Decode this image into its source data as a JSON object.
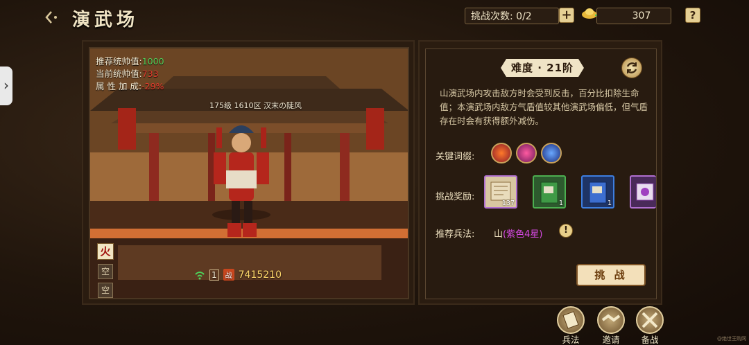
{
  "header": {
    "title": "演武场",
    "challenge_count": "挑战次数: 0/2",
    "gold": "307",
    "help": "?"
  },
  "left": {
    "stats": {
      "recommended_label": "推荐统帅值:",
      "recommended_value": "1000",
      "current_label": "当前统帅值:",
      "current_value": "733",
      "bonus_label": "属 性 加 成:",
      "bonus_value": "-29%"
    },
    "player_line": "175级  1610区 汉末の陡风",
    "element": "火",
    "slots": [
      "空",
      "空"
    ],
    "power": "7415210",
    "power_badge": "战",
    "level_badge": "1"
  },
  "right": {
    "difficulty": "难度 · 21阶",
    "description": "山演武场内攻击敌方时会受到反击，百分比扣除生命值；本演武场内敌方气盾值较其他演武场偏低，但气盾存在时会有获得额外减伤。",
    "keywords_label": "关键词缀:",
    "rewards_label": "挑战奖励:",
    "rewards": [
      {
        "count": "137",
        "color": "#b06fd0"
      },
      {
        "count": "1",
        "color": "#4caf50"
      },
      {
        "count": "1",
        "color": "#3d7ee0"
      },
      {
        "count": "",
        "color": "#b06fd0"
      }
    ],
    "recommend_label": "推荐兵法:",
    "recommend_prefix": "山",
    "recommend_detail": "(紫色4星)",
    "challenge_button": "挑 战"
  },
  "bottom": {
    "buttons": [
      "兵法",
      "邀请",
      "备战"
    ]
  },
  "watermark": "@绝世王购网"
}
